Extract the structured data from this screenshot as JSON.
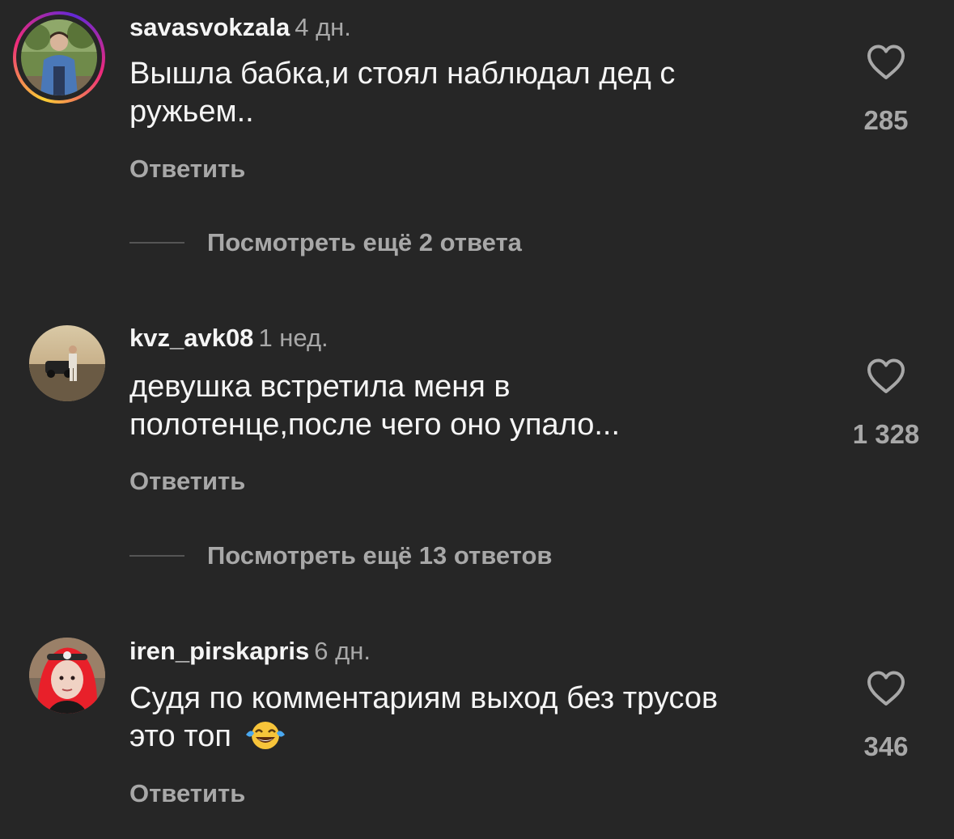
{
  "comments": [
    {
      "username": "savasvokzala",
      "time": "4 дн.",
      "text_lines": [
        "Вышла бабка,и стоял наблюдал дед с",
        "ружьем.."
      ],
      "like_count": "285",
      "reply_label": "Ответить",
      "view_replies": "Посмотреть ещё 2 ответа",
      "has_story": true
    },
    {
      "username": "kvz_avk08",
      "time": "1 нед.",
      "text_lines": [
        "девушка встретила меня в",
        "полотенце,после чего оно упало..."
      ],
      "like_count": "1 328",
      "reply_label": "Ответить",
      "view_replies": "Посмотреть ещё 13 ответов",
      "has_story": false
    },
    {
      "username": "iren_pirskapris",
      "time": "6 дн.",
      "text_lines": [
        "Судя по комментариям выход без трусов",
        "это топ"
      ],
      "like_count": "346",
      "reply_label": "Ответить",
      "has_story": false,
      "emoji": "face-with-tears-of-joy"
    }
  ],
  "icons": {
    "like": "heart-outline-icon"
  },
  "colors": {
    "background": "#262626",
    "primary_text": "#f5f5f5",
    "secondary_text": "#a8a8a8"
  }
}
